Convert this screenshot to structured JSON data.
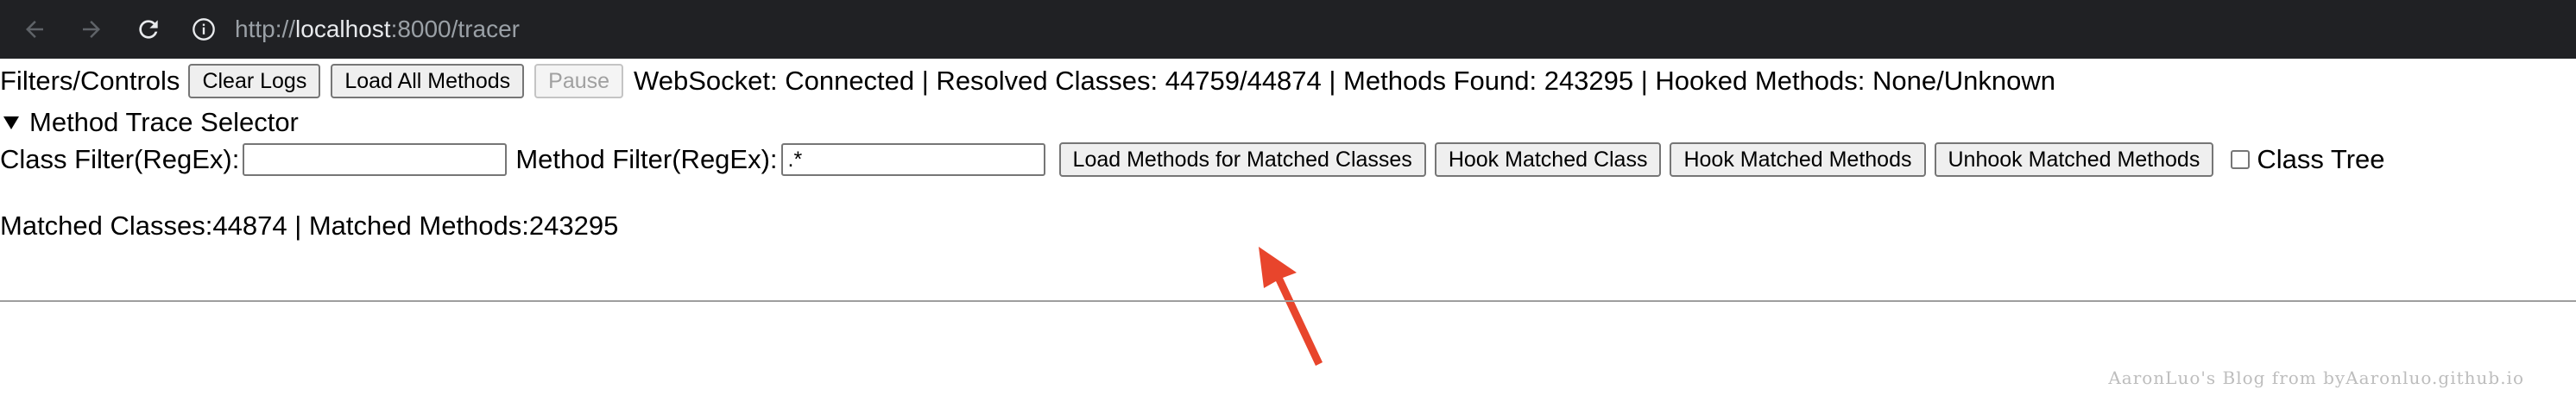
{
  "browser": {
    "url_scheme": "http://",
    "url_host": "localhost",
    "url_path": ":8000/tracer",
    "icons": [
      "back-arrow-icon",
      "forward-arrow-icon",
      "reload-icon",
      "info-icon"
    ]
  },
  "controls": {
    "title": "Filters/Controls",
    "clear_logs": "Clear Logs",
    "load_all_methods": "Load All Methods",
    "pause": "Pause",
    "status": "WebSocket: Connected | Resolved Classes: 44759/44874 | Methods Found: 243295 | Hooked Methods: None/Unknown"
  },
  "selector": {
    "summary": "Method Trace Selector",
    "class_filter_label": "Class Filter(RegEx):",
    "class_filter_value": "",
    "method_filter_label": "Method Filter(RegEx):",
    "method_filter_value": ".*",
    "load_methods_btn": "Load Methods for Matched Classes",
    "hook_class_btn": "Hook Matched Class",
    "hook_methods_btn": "Hook Matched Methods",
    "unhook_methods_btn": "Unhook Matched Methods",
    "class_tree_label": "Class Tree",
    "class_tree_checked": false,
    "matched_summary": "Matched Classes:44874 | Matched Methods:243295"
  },
  "watermark": "AaronLuo's Blog from byAaronluo.github.io",
  "colors": {
    "browser_bar": "#202124",
    "annotation_arrow": "#e8452c"
  }
}
